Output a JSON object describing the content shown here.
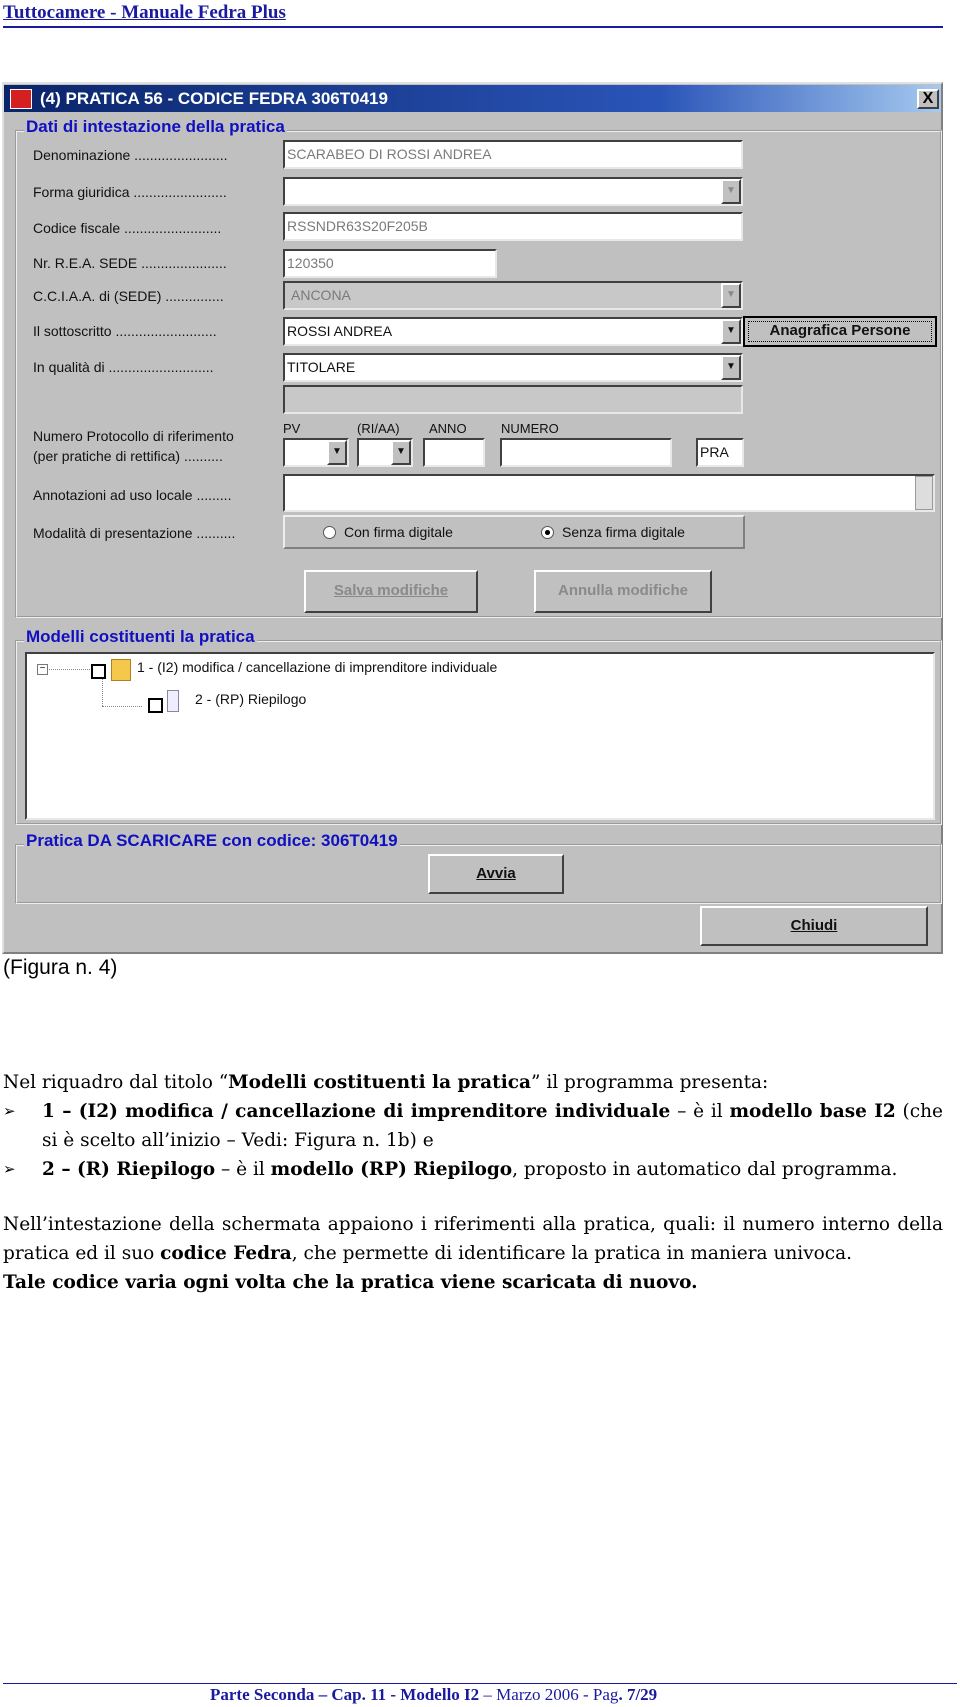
{
  "header": {
    "title": "Tuttocamere - Manuale Fedra Plus"
  },
  "window": {
    "title": "(4) PRATICA 56 - CODICE FEDRA 306T0419",
    "close_label": "X",
    "group1": {
      "legend": "Dati di intestazione della pratica",
      "denominazione": {
        "label": "Denominazione ........................",
        "value": "SCARABEO DI ROSSI ANDREA"
      },
      "forma": {
        "label": "Forma giuridica ........................",
        "value": ""
      },
      "codice": {
        "label": "Codice fiscale .........................",
        "value": "RSSNDR63S20F205B"
      },
      "rea": {
        "label": "Nr. R.E.A. SEDE ......................",
        "value": "120350"
      },
      "cciaa": {
        "label": "C.C.I.A.A. di (SEDE) ...............",
        "value": "ANCONA"
      },
      "sottoscritto": {
        "label": "Il sottoscritto ..........................",
        "value": "ROSSI ANDREA"
      },
      "anagrafica_button": "Anagrafica Persone",
      "qualita": {
        "label": "In qualità di ...........................",
        "value": "TITOLARE"
      },
      "protocollo": {
        "label1": "Numero Protocollo di riferimento",
        "label2": "(per pratiche di rettifica) ..........",
        "pv": "PV",
        "riaa": "(RI/AA)",
        "anno": "ANNO",
        "numero": "NUMERO",
        "pra": "PRA"
      },
      "annotazioni": {
        "label": "Annotazioni ad  uso locale .........",
        "value": ""
      },
      "modalita": {
        "label": "Modalità di presentazione ..........",
        "options": [
          "Con firma digitale",
          "Senza firma digitale"
        ],
        "selected": "Senza firma digitale"
      },
      "salva": "Salva modifiche",
      "annulla": "Annulla modifiche"
    },
    "group2": {
      "legend": "Modelli costituenti la pratica",
      "items": [
        "1 - (I2) modifica / cancellazione di imprenditore individuale",
        "2 - (RP) Riepilogo"
      ]
    },
    "group3": {
      "legend": "Pratica DA SCARICARE con codice: 306T0419",
      "avvia": "Avvia"
    },
    "chiudi": "Chiudi"
  },
  "caption": "(Figura n. 4)",
  "body": {
    "p1a": "Nel riquadro dal titolo “",
    "p1b": "Modelli costituenti la pratica",
    "p1c": "” il programma presenta:",
    "b1a": "1 – (I2) modifica / cancellazione di imprenditore individuale",
    "b1b": " – è il ",
    "b1c": "modello base I2",
    "b1d": " (che si è scelto all’inizio – Vedi: Figura n. 1b) e",
    "b2a": "2 – (R) Riepilogo",
    "b2b": " – è il ",
    "b2c": "modello (RP) Riepilogo",
    "b2d": ", proposto in automatico dal programma.",
    "p2a": "Nell’intestazione della schermata appaiono i riferimenti alla pratica, quali: il numero interno della pratica ed il suo ",
    "p2b": "codice Fedra",
    "p2c": ", che permette di identificare la pratica in maniera univoca.",
    "p3": "Tale codice varia ogni volta che la pratica viene scaricata di nuovo."
  },
  "footer": {
    "bold1": "Parte Seconda – Cap. 11 - Modello I2",
    "normal": " – Marzo 2006 - Pag",
    "bold2": ". 7/29"
  }
}
